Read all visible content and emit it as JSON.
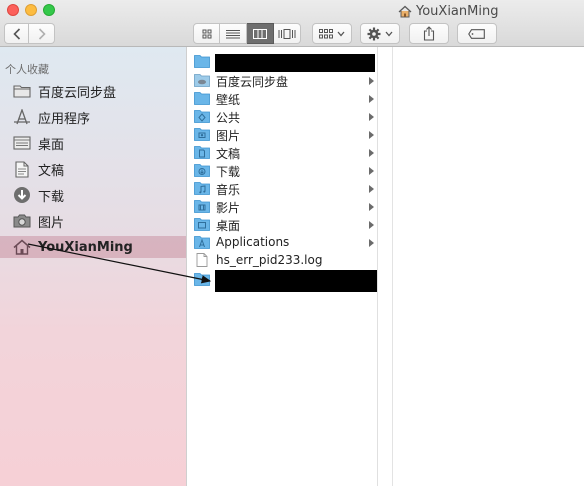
{
  "window": {
    "title": "YouXianMing",
    "title_icon": "home-icon"
  },
  "toolbar": {
    "back_icon": "chevron-left-icon",
    "forward_icon": "chevron-right-icon",
    "view_modes": [
      "icon-view-icon",
      "list-view-icon",
      "column-view-icon",
      "cover-flow-icon"
    ],
    "active_view": "column-view-icon",
    "arrange_icon": "arrange-grid-icon",
    "action_icon": "gear-icon",
    "share_icon": "share-icon",
    "tag_icon": "tag-icon"
  },
  "sidebar": {
    "section_title": "个人收藏",
    "items": [
      {
        "label": "百度云同步盘",
        "icon": "folder-icon"
      },
      {
        "label": "应用程序",
        "icon": "applications-icon"
      },
      {
        "label": "桌面",
        "icon": "desktop-icon"
      },
      {
        "label": "文稿",
        "icon": "documents-icon"
      },
      {
        "label": "下载",
        "icon": "downloads-icon"
      },
      {
        "label": "图片",
        "icon": "camera-icon"
      },
      {
        "label": "YouXianMing",
        "icon": "home-icon",
        "selected": true
      }
    ]
  },
  "column1": {
    "items": [
      {
        "name": "",
        "icon": "folder-icon",
        "redacted": true,
        "has_children": true
      },
      {
        "name": "百度云同步盘",
        "icon": "cloud-folder-icon",
        "has_children": true
      },
      {
        "name": "壁纸",
        "icon": "folder-icon",
        "has_children": true
      },
      {
        "name": "公共",
        "icon": "public-folder-icon",
        "has_children": true
      },
      {
        "name": "图片",
        "icon": "pictures-folder-icon",
        "has_children": true
      },
      {
        "name": "文稿",
        "icon": "documents-folder-icon",
        "has_children": true
      },
      {
        "name": "下载",
        "icon": "downloads-folder-icon",
        "has_children": true
      },
      {
        "name": "音乐",
        "icon": "music-folder-icon",
        "has_children": true
      },
      {
        "name": "影片",
        "icon": "movies-folder-icon",
        "has_children": true
      },
      {
        "name": "桌面",
        "icon": "desktop-folder-icon",
        "has_children": true
      },
      {
        "name": "Applications",
        "icon": "applications-folder-icon",
        "has_children": true
      },
      {
        "name": "hs_err_pid233.log",
        "icon": "document-icon",
        "has_children": false
      },
      {
        "name": "",
        "icon": "folder-icon",
        "redacted": true,
        "has_children": false
      }
    ]
  },
  "colors": {
    "folder_blue": "#6ab6e8",
    "selected_sidebar": "#c48294"
  }
}
